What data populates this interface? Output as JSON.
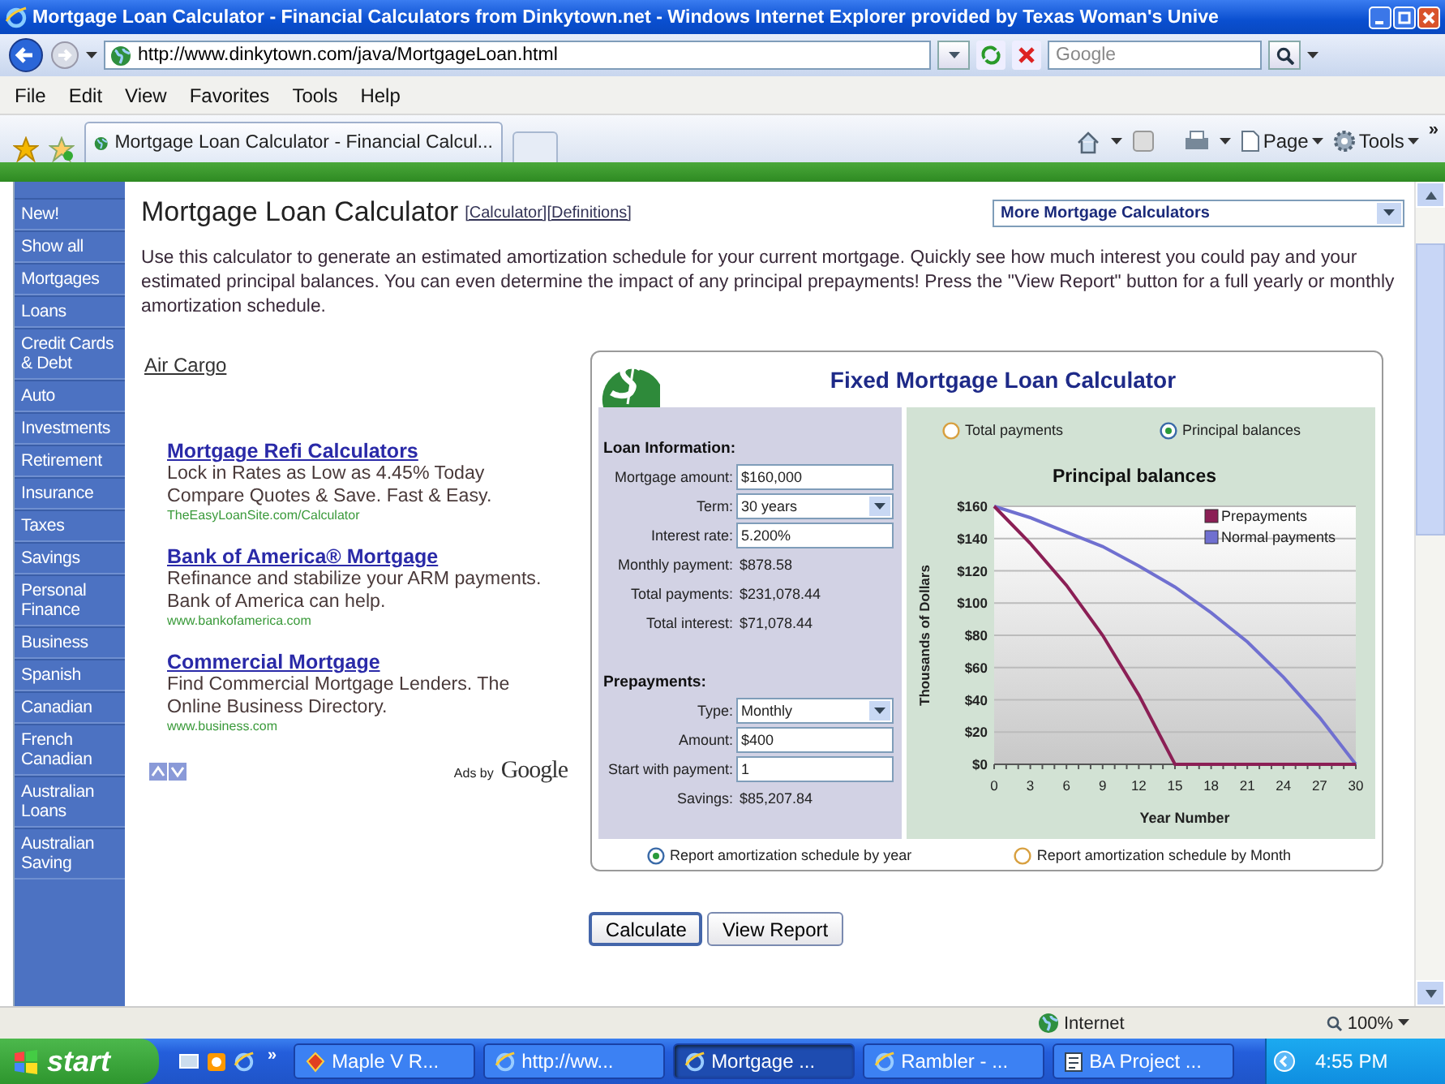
{
  "window": {
    "title": "Mortgage Loan Calculator - Financial Calculators from Dinkytown.net - Windows Internet Explorer provided by Texas Woman's Unive"
  },
  "address_bar": {
    "url": "http://www.dinkytown.com/java/MortgageLoan.html"
  },
  "search": {
    "placeholder": "Google"
  },
  "menu": [
    "File",
    "Edit",
    "View",
    "Favorites",
    "Tools",
    "Help"
  ],
  "tabs": [
    {
      "label": "Mortgage Loan Calculator - Financial Calcul...",
      "selected": true
    }
  ],
  "command_bar": {
    "items": [
      "Page",
      "Tools"
    ],
    "more": "»"
  },
  "sidebar": {
    "items": [
      "New!",
      "Show all",
      "Mortgages",
      "Loans",
      "Credit Cards & Debt",
      "Auto",
      "Investments",
      "Retirement",
      "Insurance",
      "Taxes",
      "Savings",
      "Personal Finance",
      "Business",
      "Spanish",
      "Canadian",
      "French Canadian",
      "Australian Loans",
      "Australian Saving"
    ]
  },
  "page": {
    "heading": "Mortgage Loan Calculator",
    "links": [
      "[Calculator]",
      "[Definitions]"
    ],
    "calculators_menu": "More Mortgage Calculators",
    "intro": "Use this calculator to generate an estimated amortization schedule for your current mortgage. Quickly see how much interest you could pay and your estimated principal balances. You can even determine the impact of any principal prepayments! Press the \"View Report\" button for a full yearly or monthly amortization schedule.",
    "air_cargo": "Air Cargo",
    "ads": [
      {
        "title": "Mortgage Refi Calculators",
        "lines": [
          "Lock in Rates as Low as 4.45% Today",
          "Compare Quotes & Save. Fast & Easy."
        ],
        "url": "TheEasyLoanSite.com/Calculator"
      },
      {
        "title": "Bank of America® Mortgage",
        "lines": [
          "Refinance and stabilize your ARM payments.",
          "Bank of America can help."
        ],
        "url": "www.bankofamerica.com"
      },
      {
        "title": "Commercial Mortgage",
        "lines": [
          "Find Commercial Mortgage Lenders. The",
          "Online Business Directory."
        ],
        "url": "www.business.com"
      }
    ],
    "ads_by": "Ads by",
    "ads_brand": "Google"
  },
  "calculator": {
    "title": "Fixed Mortgage Loan Calculator",
    "sections": [
      {
        "heading": "Loan Information:",
        "fields": [
          {
            "kind": "input",
            "label": "Mortgage amount:",
            "value": "$160,000"
          },
          {
            "kind": "select",
            "label": "Term:",
            "value": "30 years"
          },
          {
            "kind": "input",
            "label": "Interest rate:",
            "value": "5.200%"
          },
          {
            "kind": "output",
            "label": "Monthly payment:",
            "value": "$878.58"
          },
          {
            "kind": "output",
            "label": "Total payments:",
            "value": "$231,078.44"
          },
          {
            "kind": "output",
            "label": "Total interest:",
            "value": "$71,078.44"
          }
        ]
      },
      {
        "heading": "Prepayments:",
        "fields": [
          {
            "kind": "select",
            "label": "Type:",
            "value": "Monthly"
          },
          {
            "kind": "input",
            "label": "Amount:",
            "value": "$400"
          },
          {
            "kind": "input",
            "label": "Start with payment:",
            "value": "1"
          },
          {
            "kind": "output",
            "label": "Savings:",
            "value": "$85,207.84"
          }
        ]
      }
    ],
    "chart_options": [
      {
        "label": "Total payments",
        "selected": false
      },
      {
        "label": "Principal balances",
        "selected": true
      }
    ],
    "chart_data": {
      "type": "line",
      "title": "Principal balances",
      "xlabel": "Year Number",
      "ylabel": "Thousands of Dollars",
      "x": [
        0,
        3,
        6,
        9,
        12,
        15,
        18,
        21,
        24,
        27,
        30
      ],
      "series": [
        {
          "name": "Prepayments",
          "color": "#8b1f55",
          "values": [
            160,
            137,
            111,
            80,
            43,
            0,
            0,
            0,
            0,
            0,
            0
          ]
        },
        {
          "name": "Normal payments",
          "color": "#7070d0",
          "values": [
            160,
            153,
            144,
            135,
            123,
            110,
            94,
            76,
            54,
            29,
            0
          ]
        }
      ],
      "grid": true,
      "legend": true,
      "xlim": [
        0,
        30
      ],
      "ylim": [
        0,
        160
      ],
      "xticks": [
        0,
        3,
        6,
        9,
        12,
        15,
        18,
        21,
        24,
        27,
        30
      ],
      "yticks": [
        {
          "value": 0,
          "label": "$0"
        },
        {
          "value": 20,
          "label": "$20"
        },
        {
          "value": 40,
          "label": "$40"
        },
        {
          "value": 60,
          "label": "$60"
        },
        {
          "value": 80,
          "label": "$80"
        },
        {
          "value": 100,
          "label": "$100"
        },
        {
          "value": 120,
          "label": "$120"
        },
        {
          "value": 140,
          "label": "$140"
        },
        {
          "value": 160,
          "label": "$160"
        }
      ]
    },
    "report_options": [
      {
        "label": "Report amortization schedule by year",
        "selected": true
      },
      {
        "label": "Report amortization schedule by Month",
        "selected": false
      }
    ],
    "buttons": [
      "Calculate",
      "View Report"
    ]
  },
  "status_bar": {
    "zone": "Internet",
    "zoom": "100%"
  },
  "taskbar": {
    "start": "start",
    "quick_launch_more": "»",
    "buttons": [
      {
        "label": "Maple V R...",
        "selected": false
      },
      {
        "label": "http://ww...",
        "selected": false
      },
      {
        "label": "Mortgage ...",
        "selected": true
      },
      {
        "label": "Rambler - ...",
        "selected": false
      },
      {
        "label": "BA Project ...",
        "selected": false
      }
    ],
    "clock": "4:55 PM"
  }
}
